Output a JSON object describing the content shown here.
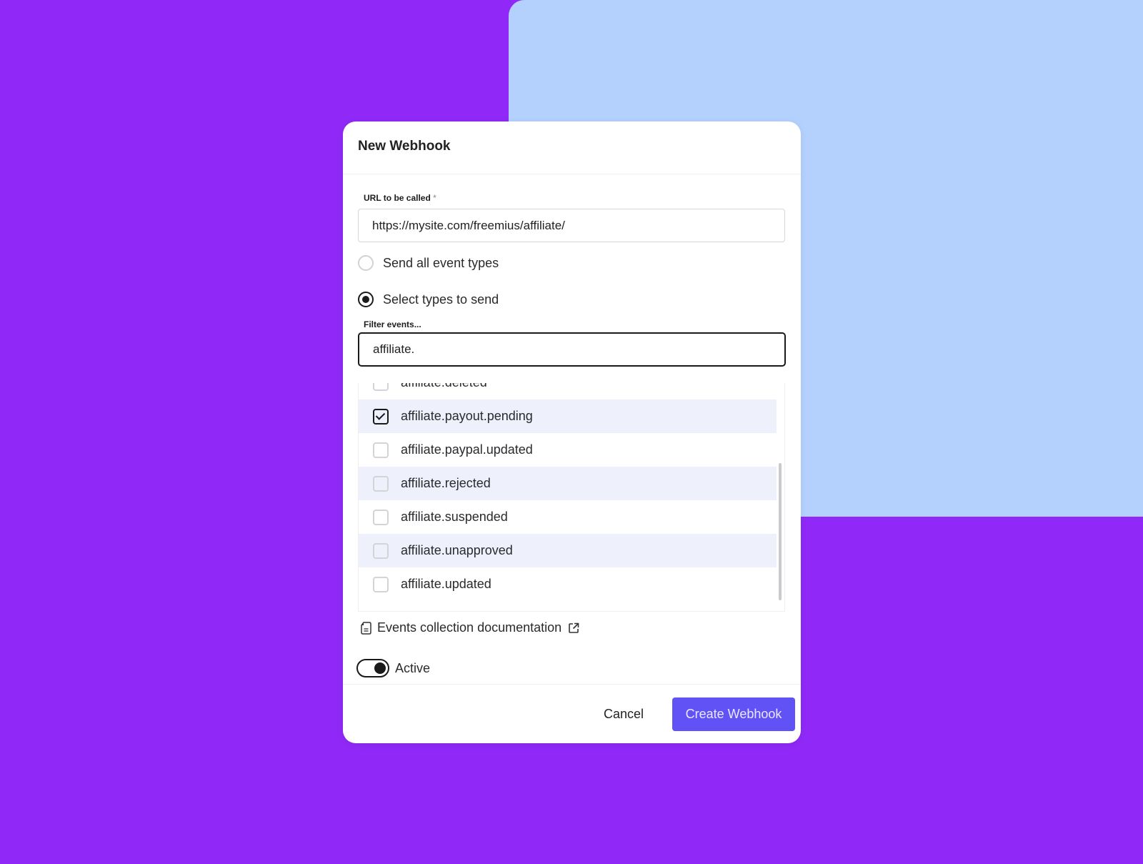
{
  "colors": {
    "background": "#9029f7",
    "panel": "#b4d1fd",
    "primary_button": "#6152f5",
    "row_highlight": "#eef0fb"
  },
  "dialog": {
    "title": "New Webhook",
    "url_field": {
      "label": "URL to be called",
      "required_marker": "*",
      "value": "https://mysite.com/freemius/affiliate/"
    },
    "event_mode": {
      "options": [
        {
          "label": "Send all event types",
          "selected": false
        },
        {
          "label": "Select types to send",
          "selected": true
        }
      ]
    },
    "filter": {
      "label": "Filter events...",
      "value": "affiliate."
    },
    "events": [
      {
        "label": "affiliate.deleted",
        "checked": false
      },
      {
        "label": "affiliate.payout.pending",
        "checked": true
      },
      {
        "label": "affiliate.paypal.updated",
        "checked": false
      },
      {
        "label": "affiliate.rejected",
        "checked": false
      },
      {
        "label": "affiliate.suspended",
        "checked": false
      },
      {
        "label": "affiliate.unapproved",
        "checked": false
      },
      {
        "label": "affiliate.updated",
        "checked": false
      }
    ],
    "doc_link": {
      "label": "Events collection documentation",
      "icon": "document-icon",
      "trailing_icon": "external-link-icon"
    },
    "active_toggle": {
      "label": "Active",
      "on": true
    },
    "buttons": {
      "cancel": "Cancel",
      "create": "Create Webhook"
    }
  }
}
